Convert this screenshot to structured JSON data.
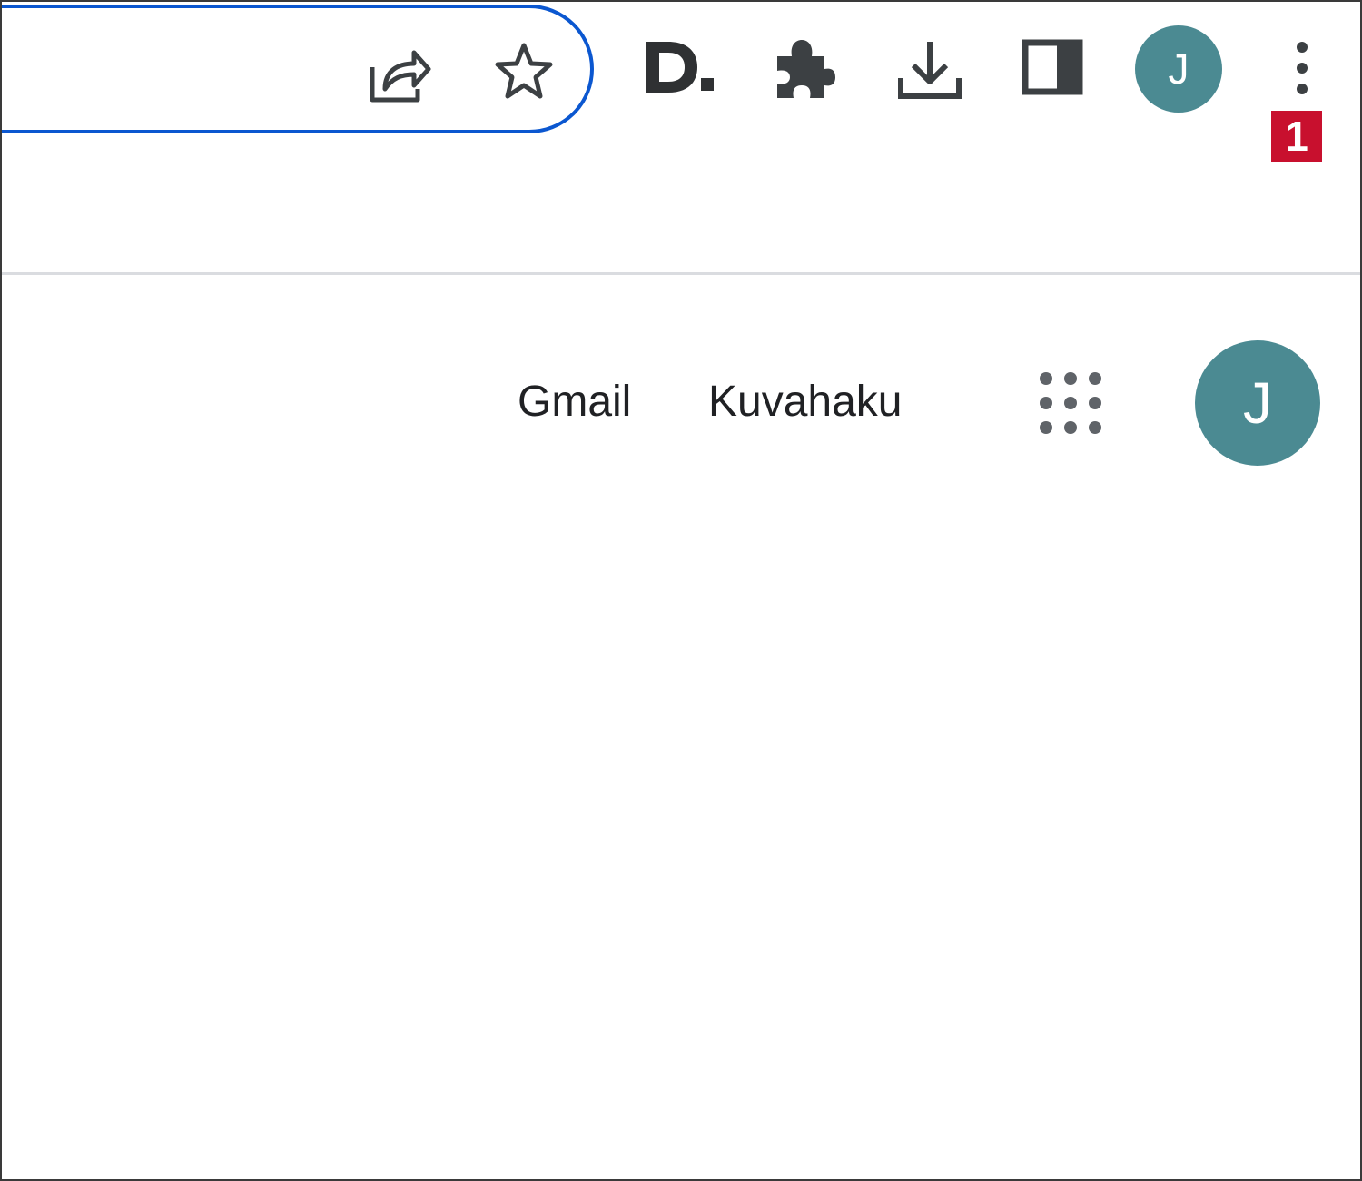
{
  "toolbar": {
    "icons": {
      "share": "share-icon",
      "bookmark": "star-icon",
      "extension_d": "d-extension-icon",
      "extensions": "puzzle-icon",
      "downloads": "download-icon",
      "side_panel": "side-panel-icon",
      "menu": "kebab-menu-icon"
    },
    "extension_d_label": "D.",
    "profile_initial": "J",
    "badge": "1",
    "colors": {
      "omnibox_border": "#0b57d0",
      "avatar": "#4b8a92",
      "badge": "#c8102e",
      "icon": "#3c4043"
    }
  },
  "page": {
    "links": {
      "gmail": "Gmail",
      "images": "Kuvahaku"
    },
    "apps_icon": "apps-grid-icon",
    "account_initial": "J"
  }
}
